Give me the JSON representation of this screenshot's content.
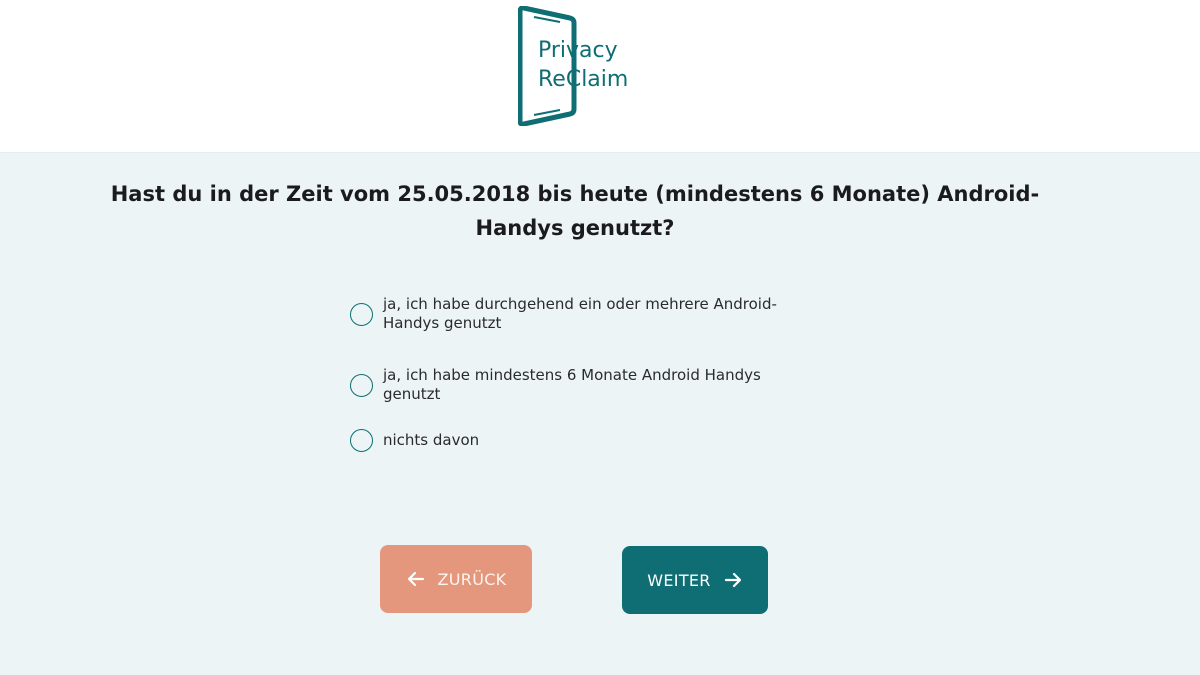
{
  "brand": {
    "line1": "Privacy",
    "line2": "ReClaim",
    "color": "#0e6e74"
  },
  "question": "Hast du in der Zeit vom 25.05.2018 bis heute (mindestens 6 Monate) Android-Handys genutzt?",
  "options": [
    {
      "label": "ja, ich habe durchgehend ein oder mehrere Android-Handys genutzt",
      "selected": false
    },
    {
      "label": "ja, ich habe mindestens 6 Monate Android Handys genutzt",
      "selected": false
    },
    {
      "label": "nichts davon",
      "selected": false
    }
  ],
  "buttons": {
    "back_label": "ZURÜCK",
    "next_label": "WEITER",
    "back_color": "#e4977c",
    "next_color": "#0e6e74"
  },
  "icons": {
    "back": "arrow-left-icon",
    "next": "arrow-right-icon"
  }
}
